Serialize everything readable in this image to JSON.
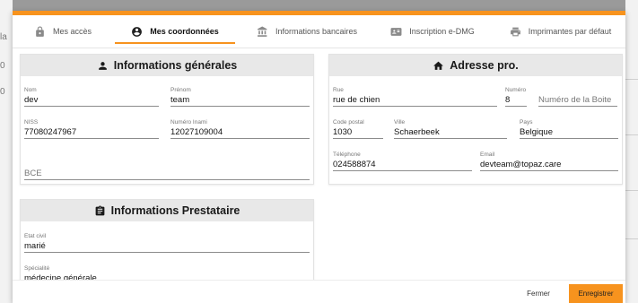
{
  "background": {
    "left_letters": [
      "la",
      "0",
      "0"
    ]
  },
  "tabs": [
    {
      "label": "Mes accès",
      "icon": "lock-icon",
      "active": false
    },
    {
      "label": "Mes coordonnées",
      "icon": "account-circle-icon",
      "active": true
    },
    {
      "label": "Informations bancaires",
      "icon": "bank-icon",
      "active": false
    },
    {
      "label": "Inscription e-DMG",
      "icon": "id-card-icon",
      "active": false
    },
    {
      "label": "Imprimantes par défaut",
      "icon": "printer-icon",
      "active": false
    }
  ],
  "general_info": {
    "title": "Informations générales",
    "icon": "person-icon",
    "nom": {
      "label": "Nom",
      "value": "dev"
    },
    "prenom": {
      "label": "Prénom",
      "value": "team"
    },
    "niss": {
      "label": "NISS",
      "value": "77080247967"
    },
    "inami": {
      "label": "Numéro Inami",
      "value": "12027109004"
    },
    "bce": {
      "label": "",
      "placeholder": "BCE"
    }
  },
  "address": {
    "title": "Adresse pro.",
    "icon": "home-icon",
    "rue": {
      "label": "Rue",
      "value": "rue de chien"
    },
    "numero": {
      "label": "Numéro",
      "value": "8"
    },
    "boite": {
      "label": "",
      "placeholder": "Numéro de la Boite"
    },
    "code_postal": {
      "label": "Code postal",
      "value": "1030"
    },
    "ville": {
      "label": "Ville",
      "value": "Schaerbeek"
    },
    "pays": {
      "label": "Pays",
      "value": "Belgique"
    },
    "telephone": {
      "label": "Téléphone",
      "value": "024588874"
    },
    "email": {
      "label": "Email",
      "value": "devteam@topaz.care"
    }
  },
  "provider_info": {
    "title": "Informations Prestataire",
    "icon": "clipboard-icon",
    "etat_civil": {
      "label": "Etat civil",
      "value": "marié"
    },
    "specialite": {
      "label": "Spécialité",
      "value": "médecine générale"
    }
  },
  "footer": {
    "close_label": "Fermer",
    "save_label": "Enregistrer"
  },
  "colors": {
    "accent": "#f7931e",
    "card_header": "#e8e8e8"
  }
}
